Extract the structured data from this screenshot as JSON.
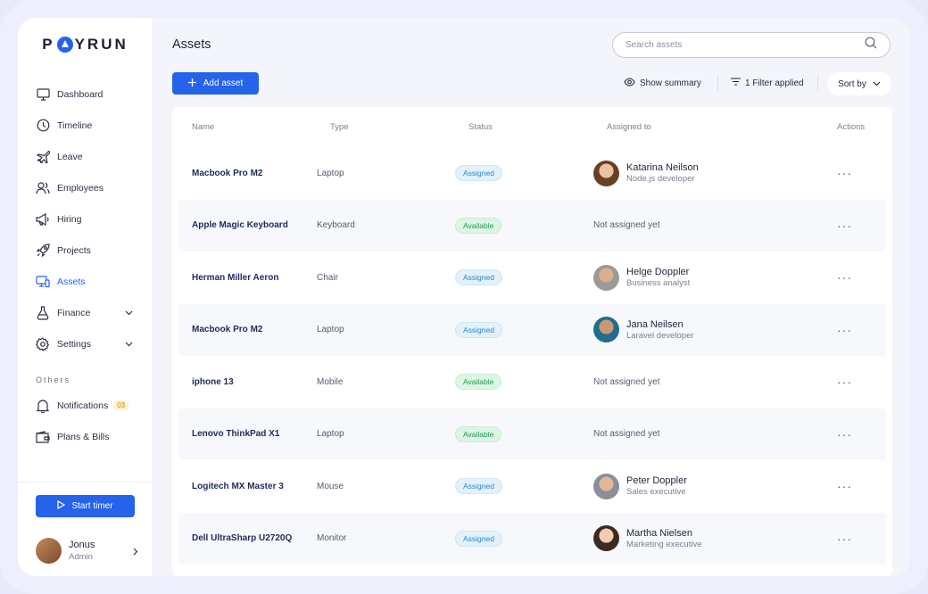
{
  "brand": {
    "logo_left": "P",
    "logo_right": "YRUN"
  },
  "colors": {
    "accent": "#2563eb",
    "assigned": "#2f86c4",
    "available": "#1f9a4a"
  },
  "sidebar": {
    "items": [
      {
        "label": "Dashboard",
        "icon": "monitor-icon"
      },
      {
        "label": "Timeline",
        "icon": "clock-icon"
      },
      {
        "label": "Leave",
        "icon": "plane-icon"
      },
      {
        "label": "Employees",
        "icon": "users-icon"
      },
      {
        "label": "Hiring",
        "icon": "megaphone-icon"
      },
      {
        "label": "Projects",
        "icon": "rocket-icon"
      },
      {
        "label": "Assets",
        "icon": "devices-icon",
        "active": true
      },
      {
        "label": "Finance",
        "icon": "flask-icon"
      },
      {
        "label": "Settings",
        "icon": "gear-icon"
      }
    ],
    "others_label": "Others",
    "notifications": {
      "label": "Notifications",
      "count": "03"
    },
    "plans": {
      "label": "Plans & Bills"
    },
    "timer_label": "Start timer",
    "profile": {
      "name": "Jonus",
      "role": "Admin"
    }
  },
  "header": {
    "title": "Assets",
    "search_placeholder": "Search assets",
    "add_label": "Add asset",
    "summary_label": "Show summary",
    "filter_label": "1 Filter applied",
    "sort_label": "Sort by"
  },
  "table": {
    "columns": [
      "Name",
      "Type",
      "Status",
      "Assigned to",
      "Actions"
    ],
    "rows": [
      {
        "name": "Macbook Pro M2",
        "type": "Laptop",
        "status": "Assigned",
        "person": "Katarina Neilson",
        "role": "Node.js developer"
      },
      {
        "name": "Apple Magic Keyboard",
        "type": "Keyboard",
        "status": "Available",
        "unassigned": "Not assigned yet"
      },
      {
        "name": "Herman Miller Aeron",
        "type": "Chair",
        "status": "Assigned",
        "person": "Helge Doppler",
        "role": "Business analyst"
      },
      {
        "name": "Macbook Pro M2",
        "type": "Laptop",
        "status": "Assigned",
        "person": "Jana Neilsen",
        "role": "Laravel developer"
      },
      {
        "name": "iphone 13",
        "type": "Mobile",
        "status": "Available",
        "unassigned": "Not assigned yet"
      },
      {
        "name": "Lenovo ThinkPad X1",
        "type": "Laptop",
        "status": "Available",
        "unassigned": "Not assigned yet"
      },
      {
        "name": "Logitech MX Master 3",
        "type": "Mouse",
        "status": "Assigned",
        "person": "Peter Doppler",
        "role": "Sales executive"
      },
      {
        "name": "Dell UltraSharp U2720Q",
        "type": "Monitor",
        "status": "Assigned",
        "person": "Martha Nielsen",
        "role": "Marketing executive"
      }
    ],
    "actions_glyph": "···"
  }
}
